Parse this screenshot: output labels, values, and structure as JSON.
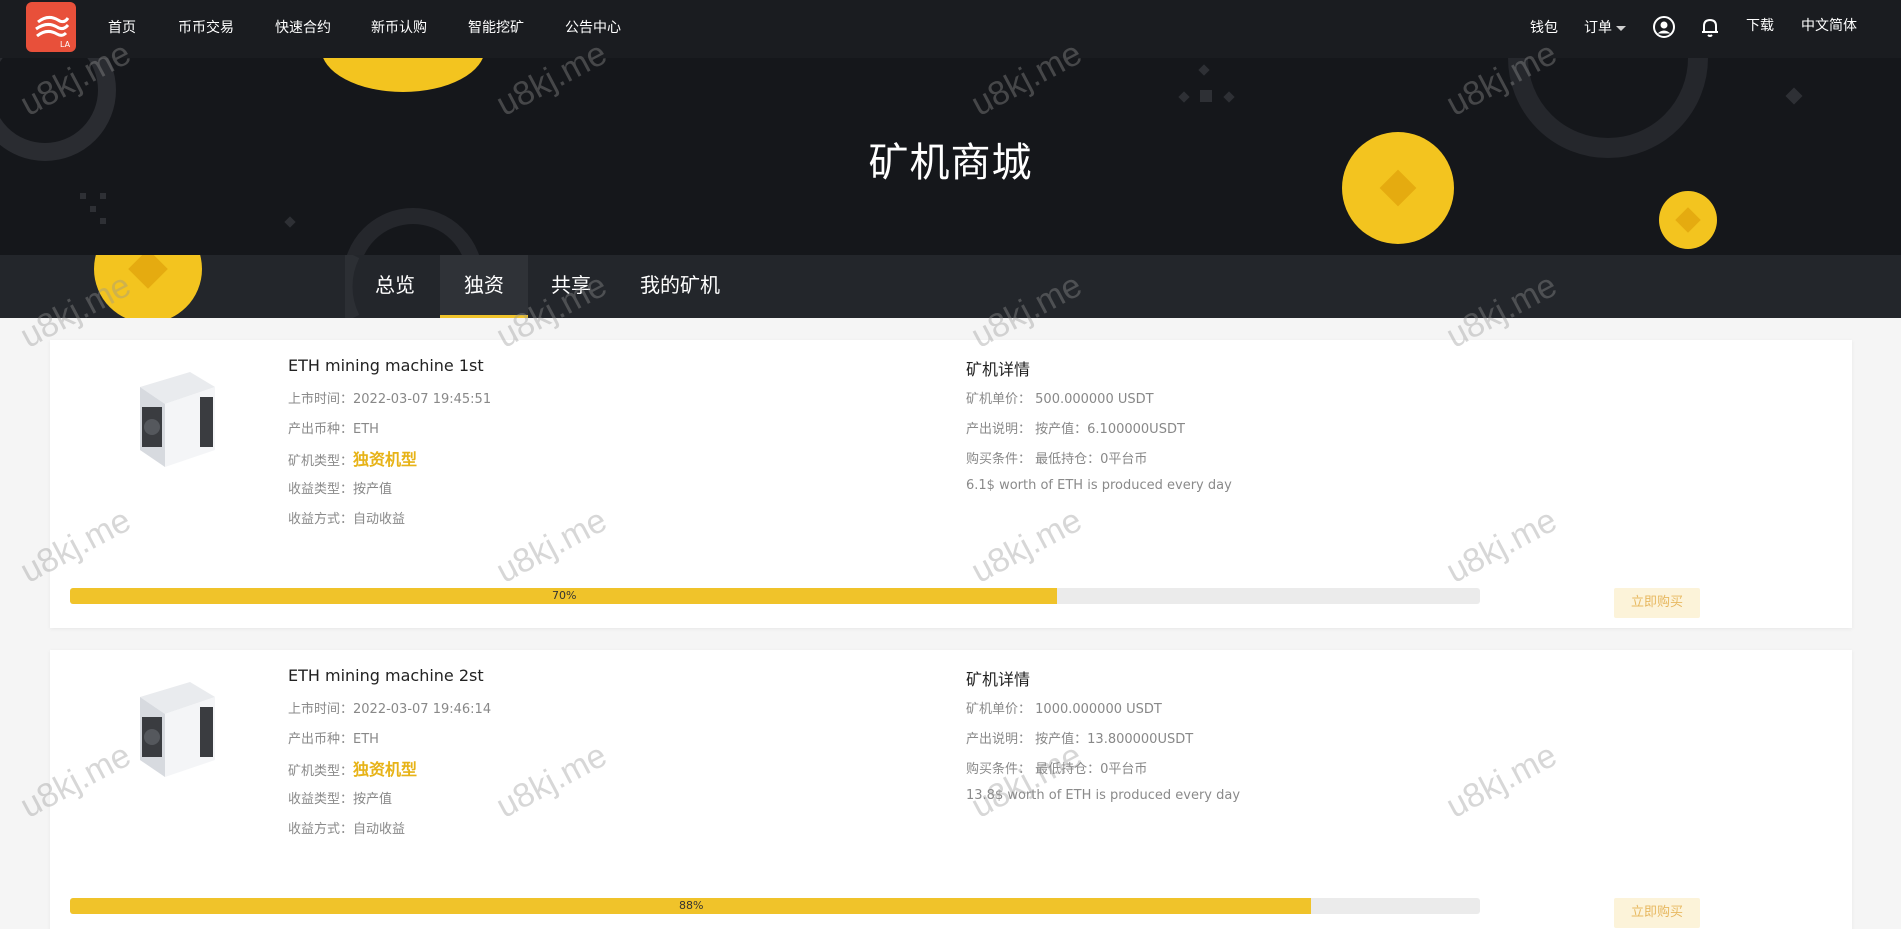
{
  "nav": {
    "links": [
      "首页",
      "币币交易",
      "快速合约",
      "新币认购",
      "智能挖矿",
      "公告中心"
    ],
    "wallet": "钱包",
    "orders": "订单",
    "download": "下载",
    "language": "中文简体",
    "logo_text": "LA"
  },
  "hero": {
    "title": "矿机商城"
  },
  "tabs": [
    {
      "label": "总览",
      "active": false
    },
    {
      "label": "独资",
      "active": true
    },
    {
      "label": "共享",
      "active": false
    },
    {
      "label": "我的矿机",
      "active": false
    }
  ],
  "machines": [
    {
      "name": "ETH mining machine 1st",
      "launch_label": "上市时间：",
      "launch_time": "2022-03-07 19:45:51",
      "coin_label": "产出币种：",
      "coin": "ETH",
      "type_label": "矿机类型：",
      "type": "独资机型",
      "income_type_label": "收益类型：",
      "income_type": "按产值",
      "income_method_label": "收益方式：",
      "income_method": "自动收益",
      "detail_title": "矿机详情",
      "price_label": "矿机单价：",
      "price": "500.000000 USDT",
      "output_label": "产出说明：",
      "output": "按产值：6.100000USDT",
      "condition_label": "购买条件：",
      "condition": "最低持仓：0平台币",
      "description": "6.1$ worth of ETH is produced every day",
      "progress": 0.7,
      "progress_label": "70%",
      "buy_label": "立即购买"
    },
    {
      "name": "ETH mining machine 2st",
      "launch_label": "上市时间：",
      "launch_time": "2022-03-07 19:46:14",
      "coin_label": "产出币种：",
      "coin": "ETH",
      "type_label": "矿机类型：",
      "type": "独资机型",
      "income_type_label": "收益类型：",
      "income_type": "按产值",
      "income_method_label": "收益方式：",
      "income_method": "自动收益",
      "detail_title": "矿机详情",
      "price_label": "矿机单价：",
      "price": "1000.000000 USDT",
      "output_label": "产出说明：",
      "output": "按产值：13.800000USDT",
      "condition_label": "购买条件：",
      "condition": "最低持仓：0平台币",
      "description": "13.8$ worth of ETH is produced every day",
      "progress": 0.88,
      "progress_label": "88%",
      "buy_label": "立即购买"
    }
  ],
  "watermark": "u8kj.me",
  "colors": {
    "accent": "#f0c32a",
    "nav_bg": "#1a1c20",
    "hero_bg": "#15171b",
    "highlight": "#e7b317",
    "logo": "#e8503a"
  },
  "icons": {
    "user": "user-circle-icon",
    "bell": "bell-icon",
    "orders_caret": "caret-down-icon"
  }
}
